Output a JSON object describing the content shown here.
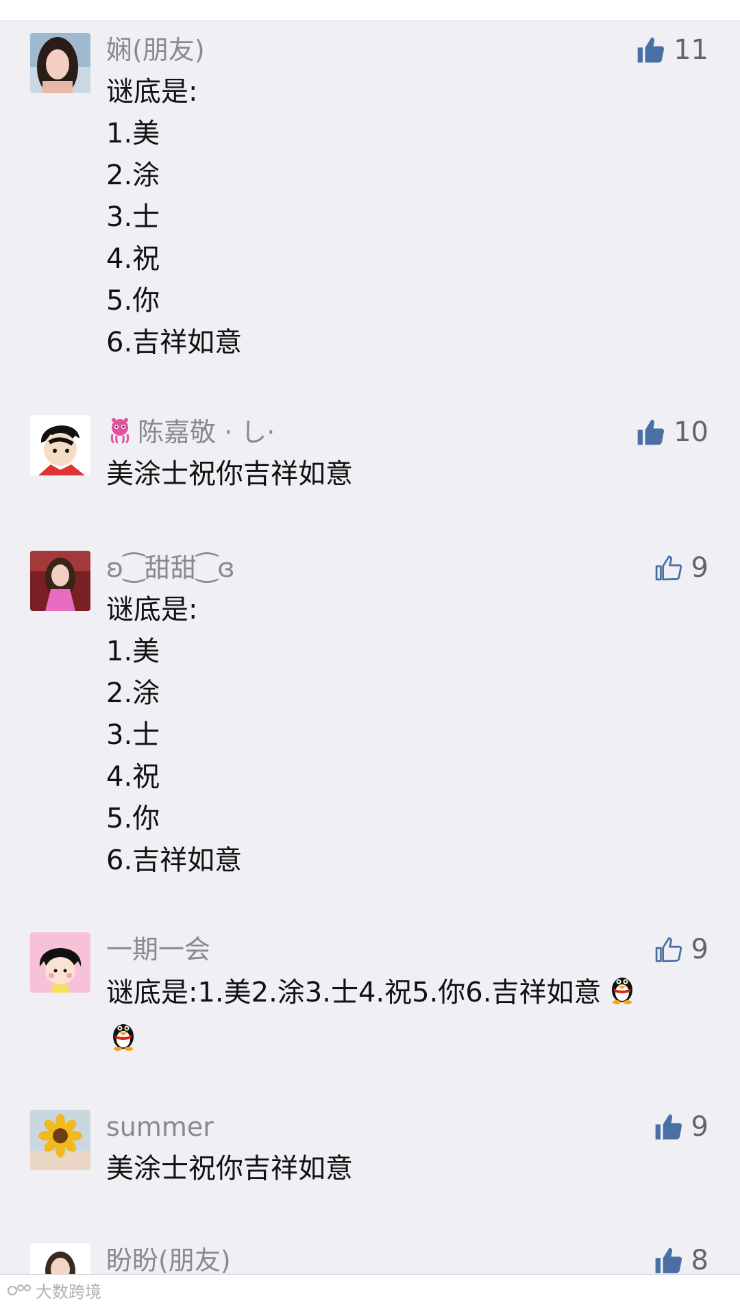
{
  "comments": [
    {
      "name": "娴(朋友)",
      "likes": "11",
      "liked": true,
      "lines": [
        "谜底是:",
        "1.美",
        "2.涂",
        "3.士",
        "4.祝",
        "5.你",
        "6.吉祥如意"
      ]
    },
    {
      "name": "陈嘉敬 · し·",
      "likes": "10",
      "liked": true,
      "lines": [
        "美涂士祝你吉祥如意"
      ]
    },
    {
      "name": "ʚ⁐甜甜⁐ɞ",
      "likes": "9",
      "liked": false,
      "lines": [
        "谜底是:",
        "1.美",
        "2.涂",
        "3.士",
        "4.祝",
        "5.你",
        "6.吉祥如意"
      ]
    },
    {
      "name": "一期一会",
      "likes": "9",
      "liked": false,
      "lines": [
        "谜底是:1.美2.涂3.士4.祝5.你6.吉祥如意"
      ]
    },
    {
      "name": "summer",
      "likes": "9",
      "liked": true,
      "lines": [
        "美涂士祝你吉祥如意"
      ]
    },
    {
      "name": "盼盼(朋友)",
      "likes": "8",
      "liked": true,
      "lines": []
    }
  ],
  "watermark": "大数跨境",
  "colors": {
    "background": "#efeff4",
    "like_filled": "#4a6fa5",
    "like_outline": "#4a6fa5",
    "name_text": "#8a8a8e"
  },
  "icons": {
    "like_filled": "thumbs-up-filled-icon",
    "like_outline": "thumbs-up-outline-icon",
    "emoji": "qq-penguin-icon",
    "name_badge": "pink-octopus-icon"
  }
}
